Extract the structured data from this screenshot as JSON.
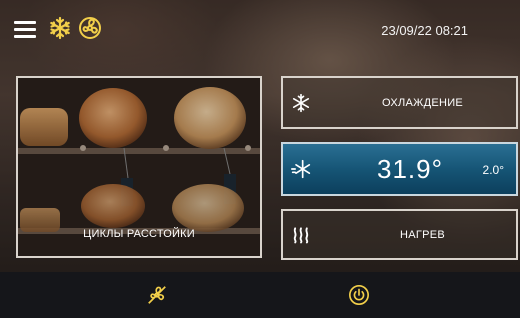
{
  "header": {
    "datetime": "23/09/22 08:21",
    "icons": [
      "menu-icon",
      "snowflake-icon",
      "fan-icon"
    ],
    "accent_color": "#f2cf4a"
  },
  "cycles_card": {
    "label": "ЦИКЛЫ РАССТОЙКИ"
  },
  "modes": {
    "cooling_label": "ОХЛАЖДЕНИЕ",
    "heating_label": "НАГРЕВ",
    "temperature": "31.9°",
    "delta": "2.0°",
    "temp_panel_color": "#165576"
  },
  "bottom_bar": {
    "icons": [
      "fan-off-icon",
      "power-icon"
    ]
  }
}
